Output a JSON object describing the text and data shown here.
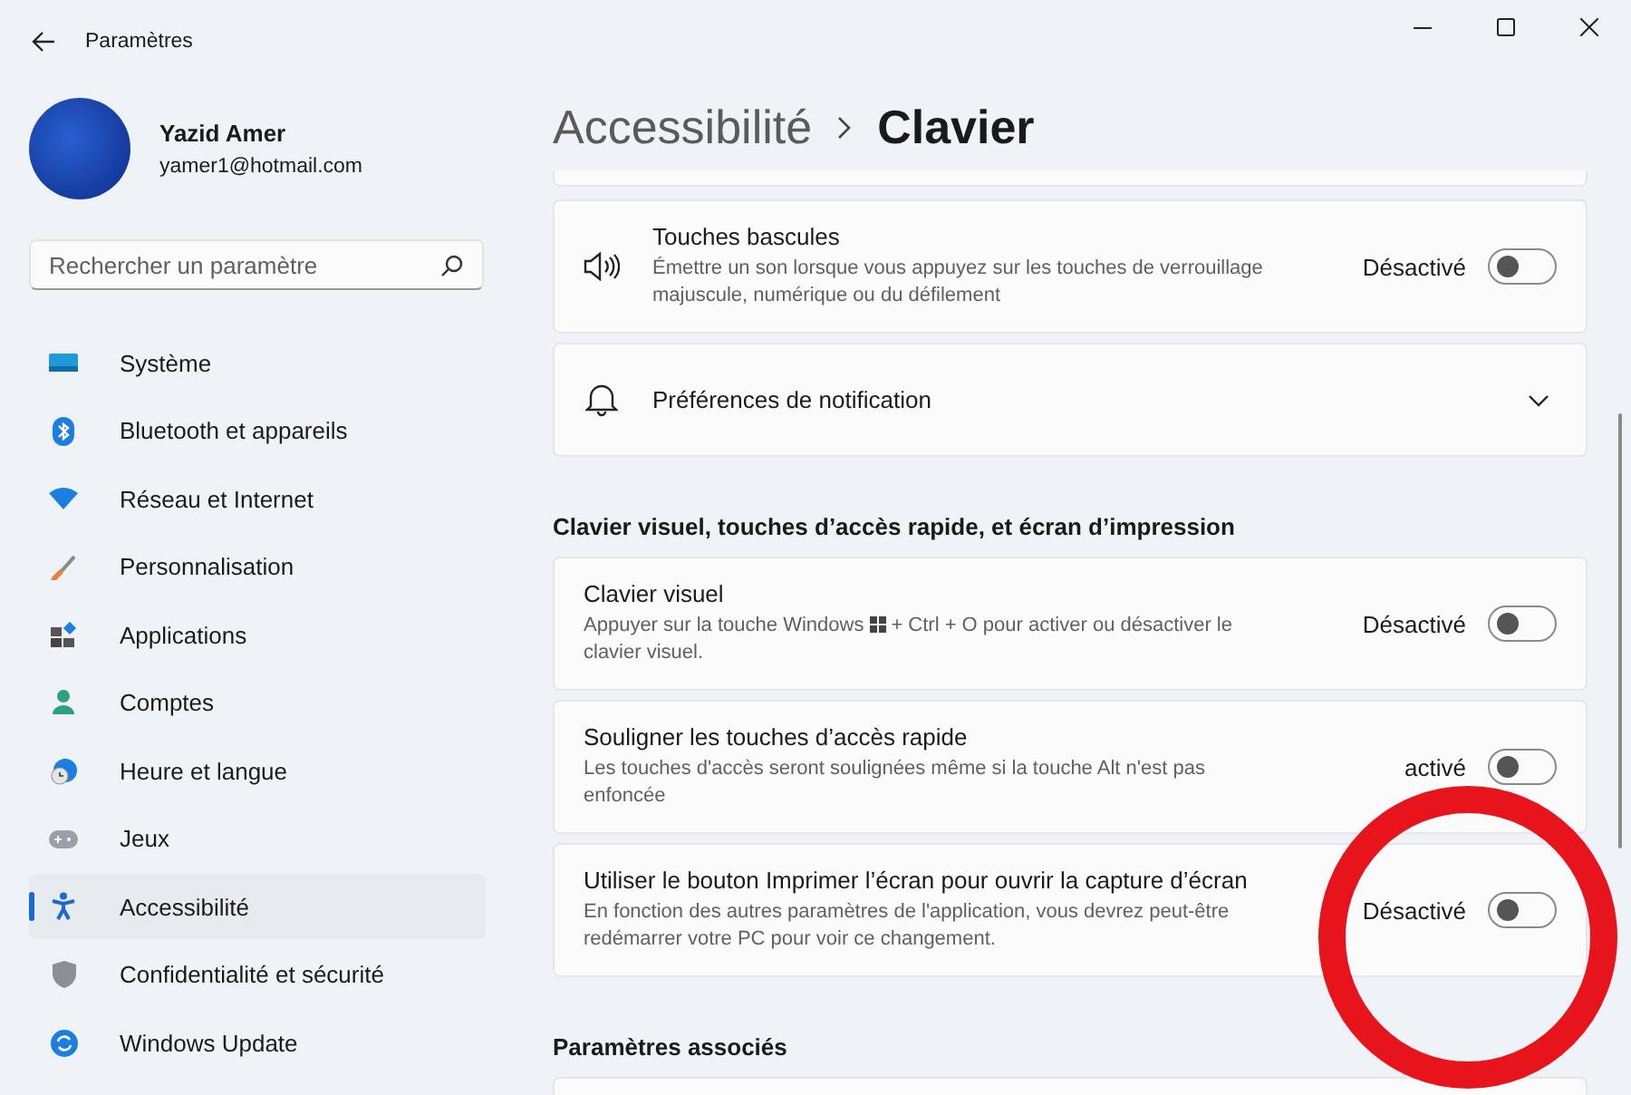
{
  "window": {
    "title": "Paramètres"
  },
  "account": {
    "name": "Yazid Amer",
    "email": "yamer1@hotmail.com"
  },
  "search": {
    "placeholder": "Rechercher un paramètre"
  },
  "sidebar": {
    "items": [
      {
        "label": "Système",
        "kind": "system",
        "selected": false
      },
      {
        "label": "Bluetooth et appareils",
        "kind": "bluetooth",
        "selected": false
      },
      {
        "label": "Réseau et Internet",
        "kind": "network",
        "selected": false
      },
      {
        "label": "Personnalisation",
        "kind": "brush",
        "selected": false
      },
      {
        "label": "Applications",
        "kind": "apps",
        "selected": false
      },
      {
        "label": "Comptes",
        "kind": "person",
        "selected": false
      },
      {
        "label": "Heure et langue",
        "kind": "clock",
        "selected": false
      },
      {
        "label": "Jeux",
        "kind": "gamepad",
        "selected": false
      },
      {
        "label": "Accessibilité",
        "kind": "accessibility",
        "selected": true
      },
      {
        "label": "Confidentialité et sécurité",
        "kind": "shield",
        "selected": false
      },
      {
        "label": "Windows Update",
        "kind": "update",
        "selected": false
      }
    ]
  },
  "breadcrumb": [
    "Accessibilité",
    "Clavier"
  ],
  "sections": [
    {
      "cards": [
        {
          "kind": "toggle",
          "title": "Touches bascules",
          "description": [
            "Émettre un son lorsque vous appuyez sur les touches de verrouillage majuscule, numérique ou du défilement"
          ],
          "status": "Désactivé",
          "on": false
        },
        {
          "kind": "expander",
          "title": "Préférences de notification",
          "expanded": false
        }
      ]
    },
    {
      "heading": "Clavier visuel, touches d’accès rapide, et écran d’impression",
      "cards": [
        {
          "kind": "toggle",
          "title": "Clavier visuel",
          "description": [
            "Appuyer sur la touche Windows",
            "+ Ctrl + O pour activer ou désactiver le clavier visuel."
          ],
          "status": "Désactivé",
          "on": false
        },
        {
          "kind": "toggle",
          "title": "Souligner les touches d’accès rapide",
          "description": [
            "Les touches d'accès seront soulignées même si la touche Alt n'est pas enfoncée"
          ],
          "status": "activé",
          "on": false
        },
        {
          "kind": "toggle",
          "title": "Utiliser le bouton Imprimer l’écran pour ouvrir la capture d’écran",
          "description": [
            "En fonction des autres paramètres de l'application, vous devrez peut-être redémarrer votre PC pour voir ce changement."
          ],
          "status": "Désactivé",
          "on": false
        }
      ]
    },
    {
      "heading": "Paramètres associés"
    }
  ],
  "annotation": {
    "kind": "circle"
  }
}
